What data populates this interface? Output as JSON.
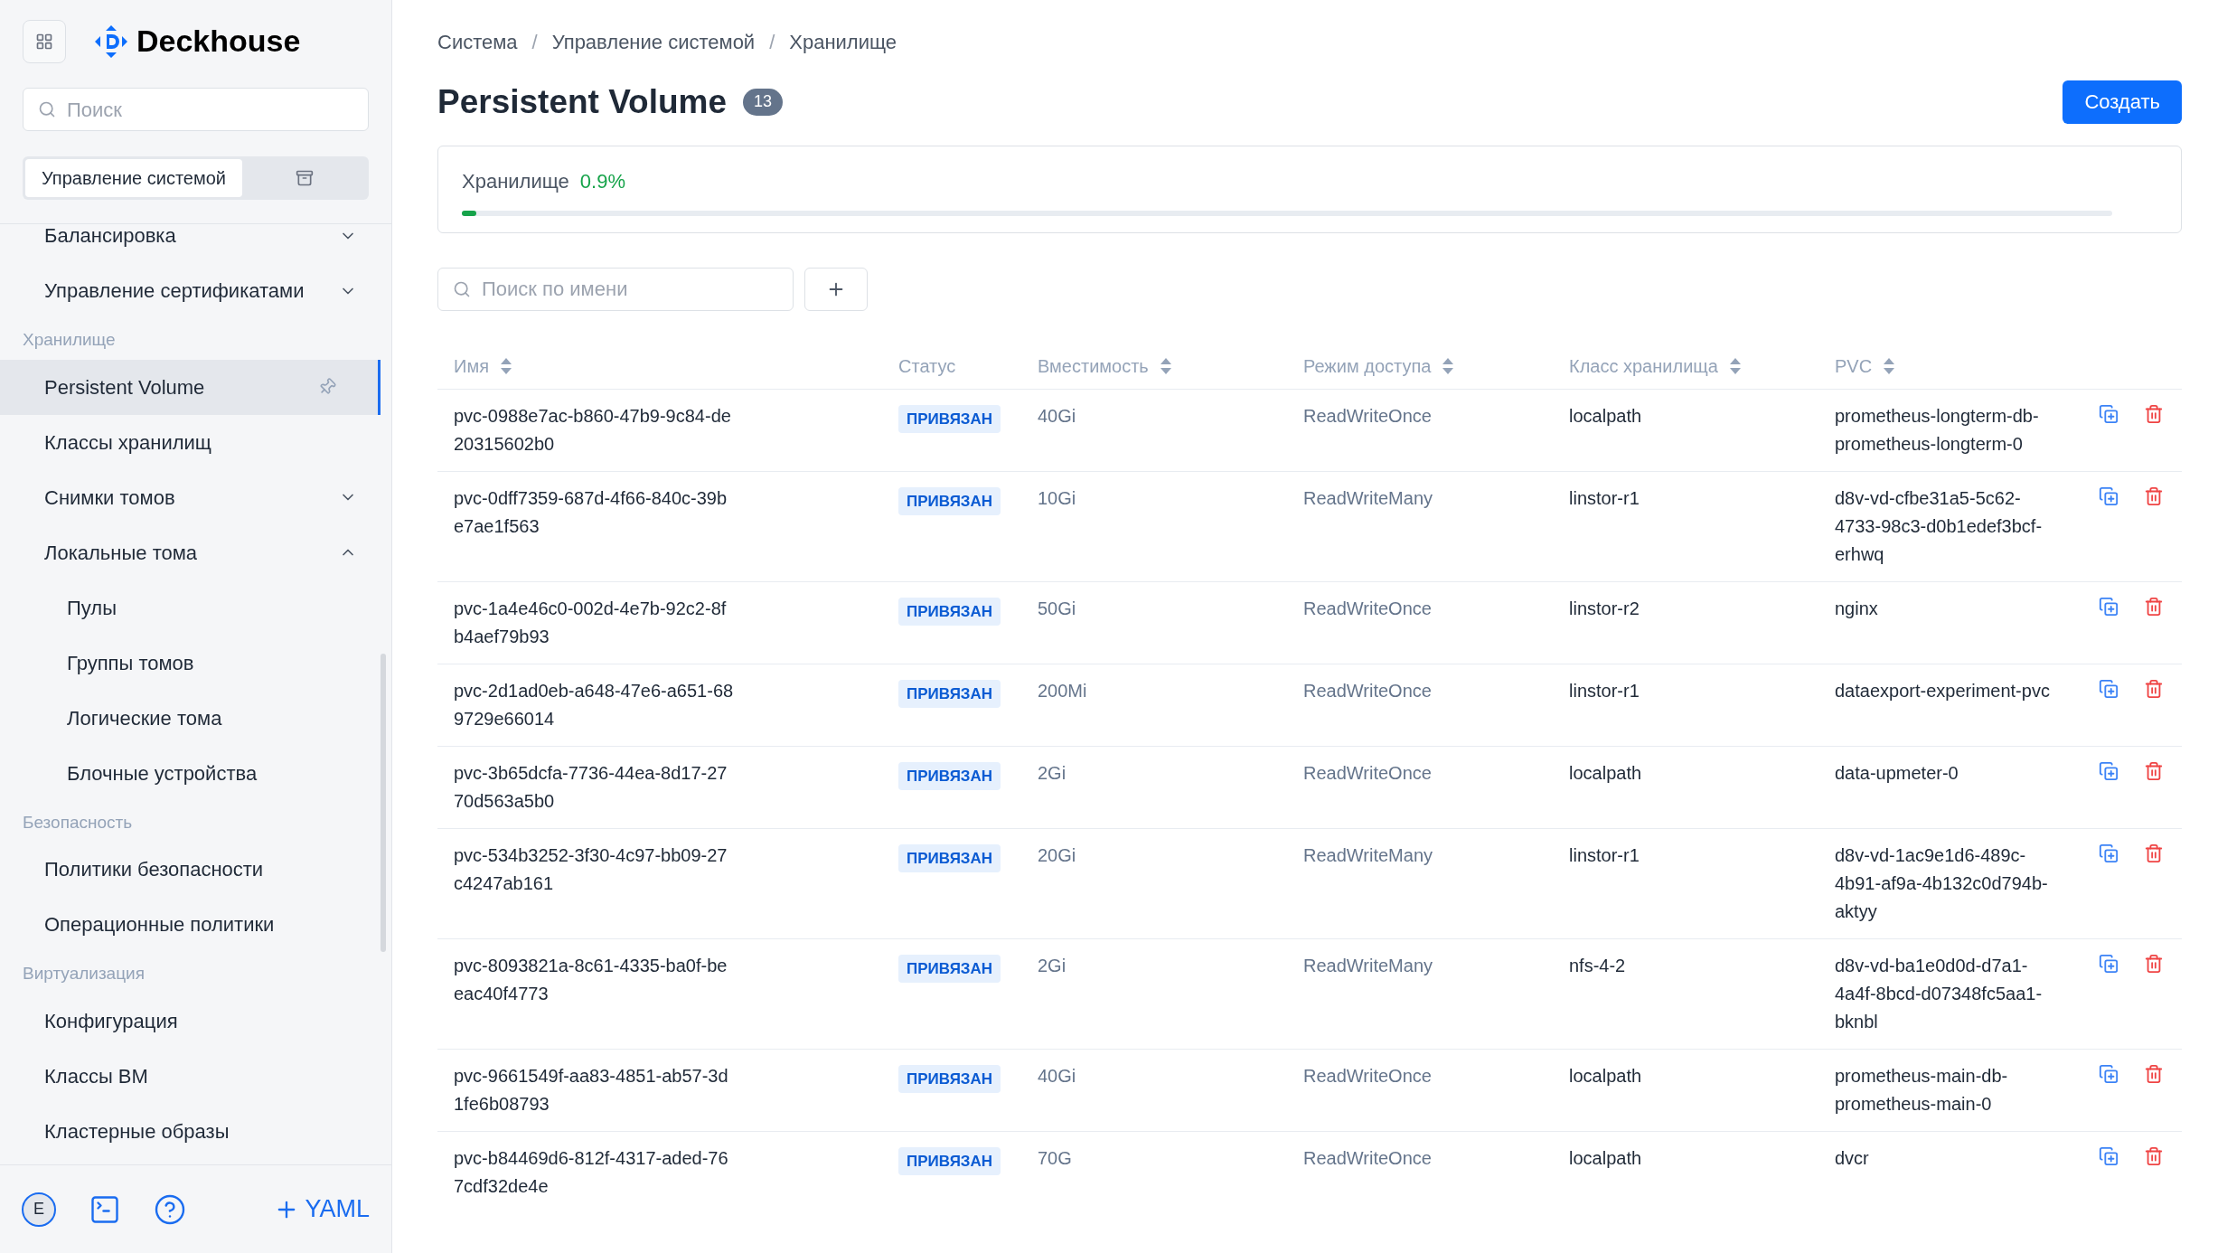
{
  "sidebar": {
    "brand": "Deckhouse",
    "search": {
      "placeholder": "Поиск"
    },
    "segments": [
      {
        "kind": "text",
        "label": "Управление системой",
        "selected": true
      },
      {
        "kind": "icon",
        "selected": false
      }
    ],
    "items": [
      {
        "kind": "group",
        "label": "Балансировка",
        "expanded": false,
        "selected": false
      },
      {
        "kind": "group",
        "label": "Управление сертификатами",
        "expanded": false,
        "selected": false
      },
      {
        "kind": "header",
        "label": "Хранилище"
      },
      {
        "kind": "link",
        "label": "Persistent Volume",
        "selected": true
      },
      {
        "kind": "link",
        "label": "Классы хранилищ",
        "selected": false
      },
      {
        "kind": "group",
        "label": "Снимки томов",
        "expanded": false,
        "selected": false
      },
      {
        "kind": "group",
        "label": "Локальные тома",
        "expanded": true,
        "selected": false,
        "children": [
          {
            "kind": "link",
            "label": "Пулы",
            "selected": false
          },
          {
            "kind": "link",
            "label": "Группы томов",
            "selected": false
          },
          {
            "kind": "link",
            "label": "Логические тома",
            "selected": false
          },
          {
            "kind": "link",
            "label": "Блочные устройства",
            "selected": false
          }
        ]
      },
      {
        "kind": "header",
        "label": "Безопасность"
      },
      {
        "kind": "link",
        "label": "Политики безопасности",
        "selected": false
      },
      {
        "kind": "link",
        "label": "Операционные политики",
        "selected": false
      },
      {
        "kind": "header",
        "label": "Виртуализация"
      },
      {
        "kind": "link",
        "label": "Конфигурация",
        "selected": false
      },
      {
        "kind": "link",
        "label": "Классы ВМ",
        "selected": false
      },
      {
        "kind": "link",
        "label": "Кластерные образы",
        "selected": false
      }
    ],
    "footer": {
      "avatar": "E",
      "yaml_button": "YAML"
    }
  },
  "breadcrumbs": [
    {
      "label": "Система"
    },
    {
      "separator": "/",
      "label": "Управление системой"
    },
    {
      "separator": "/",
      "label": "Хранилище"
    }
  ],
  "page": {
    "title": "Persistent Volume",
    "count": "13",
    "create_button": "Создать"
  },
  "storage": {
    "label": "Хранилище",
    "percent": "0.9%",
    "level": 0.009
  },
  "filter": {
    "placeholder": "Поиск по имени"
  },
  "table": {
    "columns": [
      {
        "label": "Имя",
        "sortable": true
      },
      {
        "label": "Статус",
        "sortable": false
      },
      {
        "label": "Вместимость",
        "sortable": true
      },
      {
        "label": "Режим доступа",
        "sortable": true
      },
      {
        "label": "Класс хранилища",
        "sortable": true
      },
      {
        "label": "PVC",
        "sortable": true
      }
    ],
    "rows": [
      {
        "name": "pvc-0988e7ac-b860-47b9-9c84-de20315602b0",
        "status": "ПРИВЯЗАН",
        "capacity": "40Gi",
        "access": "ReadWriteOnce",
        "class": "localpath",
        "pvc": "prometheus-longterm-db-prometheus-longterm-0"
      },
      {
        "name": "pvc-0dff7359-687d-4f66-840c-39be7ae1f563",
        "status": "ПРИВЯЗАН",
        "capacity": "10Gi",
        "access": "ReadWriteMany",
        "class": "linstor-r1",
        "pvc": "d8v-vd-cfbe31a5-5c62-4733-98c3-d0b1edef3bcf-erhwq"
      },
      {
        "name": "pvc-1a4e46c0-002d-4e7b-92c2-8fb4aef79b93",
        "status": "ПРИВЯЗАН",
        "capacity": "50Gi",
        "access": "ReadWriteOnce",
        "class": "linstor-r2",
        "pvc": "nginx"
      },
      {
        "name": "pvc-2d1ad0eb-a648-47e6-a651-689729e66014",
        "status": "ПРИВЯЗАН",
        "capacity": "200Mi",
        "access": "ReadWriteOnce",
        "class": "linstor-r1",
        "pvc": "dataexport-experiment-pvc"
      },
      {
        "name": "pvc-3b65dcfa-7736-44ea-8d17-2770d563a5b0",
        "status": "ПРИВЯЗАН",
        "capacity": "2Gi",
        "access": "ReadWriteOnce",
        "class": "localpath",
        "pvc": "data-upmeter-0"
      },
      {
        "name": "pvc-534b3252-3f30-4c97-bb09-27c4247ab161",
        "status": "ПРИВЯЗАН",
        "capacity": "20Gi",
        "access": "ReadWriteMany",
        "class": "linstor-r1",
        "pvc": "d8v-vd-1ac9e1d6-489c-4b91-af9a-4b132c0d794b-aktyy"
      },
      {
        "name": "pvc-8093821a-8c61-4335-ba0f-beeac40f4773",
        "status": "ПРИВЯЗАН",
        "capacity": "2Gi",
        "access": "ReadWriteMany",
        "class": "nfs-4-2",
        "pvc": "d8v-vd-ba1e0d0d-d7a1-4a4f-8bcd-d07348fc5aa1-bknbl"
      },
      {
        "name": "pvc-9661549f-aa83-4851-ab57-3d1fe6b08793",
        "status": "ПРИВЯЗАН",
        "capacity": "40Gi",
        "access": "ReadWriteOnce",
        "class": "localpath",
        "pvc": "prometheus-main-db-prometheus-main-0"
      },
      {
        "name": "pvc-b84469d6-812f-4317-aded-767cdf32de4e",
        "status": "ПРИВЯЗАН",
        "capacity": "70G",
        "access": "ReadWriteOnce",
        "class": "localpath",
        "pvc": "dvcr"
      }
    ]
  }
}
